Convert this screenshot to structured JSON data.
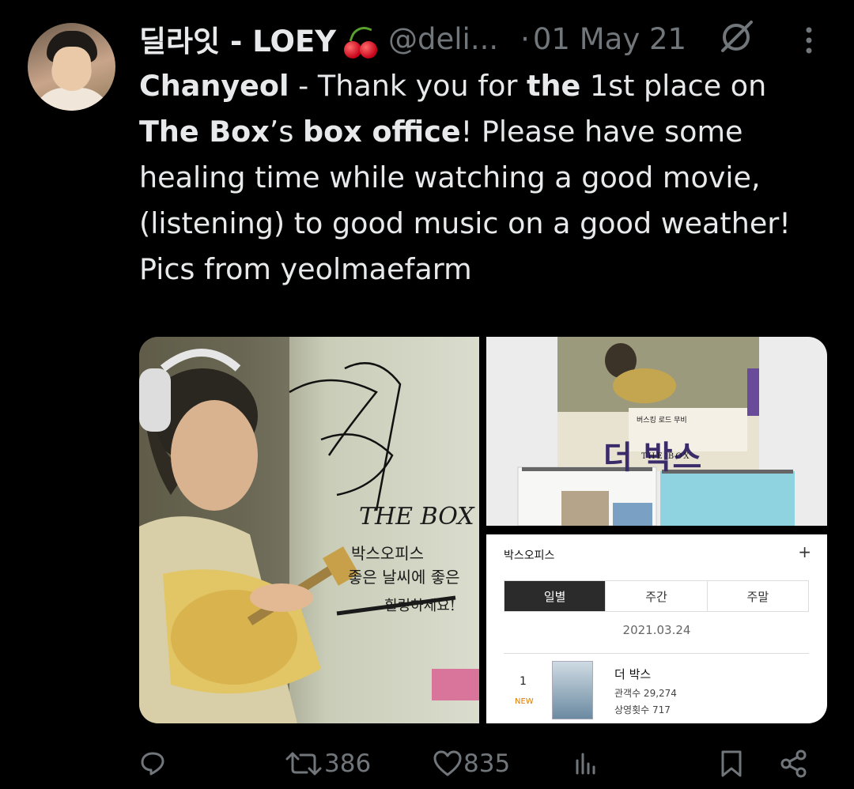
{
  "tweet": {
    "author_name": "딜라잇 - LOEY",
    "author_emoji": "cherries-emoji",
    "handle": "@deli...",
    "separator": "·",
    "date": "01 May 21",
    "text_lines": [
      {
        "parts": [
          {
            "t": "Chanyeol",
            "b": true
          },
          {
            "t": " - Thank you for ",
            "b": false
          },
          {
            "t": "the",
            "b": true
          },
          {
            "t": " 1st place on",
            "b": false
          }
        ]
      },
      {
        "parts": [
          {
            "t": "The Box",
            "b": true
          },
          {
            "t": "’s ",
            "b": false
          },
          {
            "t": "box office",
            "b": true
          },
          {
            "t": "! Please have some",
            "b": false
          }
        ]
      },
      {
        "parts": [
          {
            "t": "healing time while watching a good movie,",
            "b": false
          }
        ]
      },
      {
        "parts": [
          {
            "t": "(listening) to good music on a good weather!",
            "b": false
          }
        ]
      },
      {
        "parts": [
          {
            "t": " ",
            "b": false
          }
        ]
      },
      {
        "parts": [
          {
            "t": "Pics from yeolmaefarm",
            "b": false
          }
        ]
      }
    ]
  },
  "media": {
    "photo1_caption": [
      "THE BOX",
      "박스오피스",
      "좋은 날씨에 좋은",
      "힐링하세요!"
    ],
    "photo2_caption": {
      "title": "더 박스",
      "subtitle": "THE BOX",
      "small": "버스킹 로드 무비"
    },
    "box_office": {
      "title": "박스오피스",
      "plus": "+",
      "tabs": [
        {
          "label": "일별",
          "active": true
        },
        {
          "label": "주간",
          "active": false
        },
        {
          "label": "주말",
          "active": false
        }
      ],
      "date": "2021.03.24",
      "rank": "1",
      "badge": "NEW",
      "movie_title": "더 박스",
      "audience": "관객수 29,274",
      "screenings": "상영횟수 717"
    }
  },
  "actions": {
    "reply_count": "",
    "retweet_count": "386",
    "like_count": "835"
  },
  "colors": {
    "background": "#000000",
    "text": "#e7e9ea",
    "muted": "#71767b",
    "accent_new": "#e07b00"
  }
}
